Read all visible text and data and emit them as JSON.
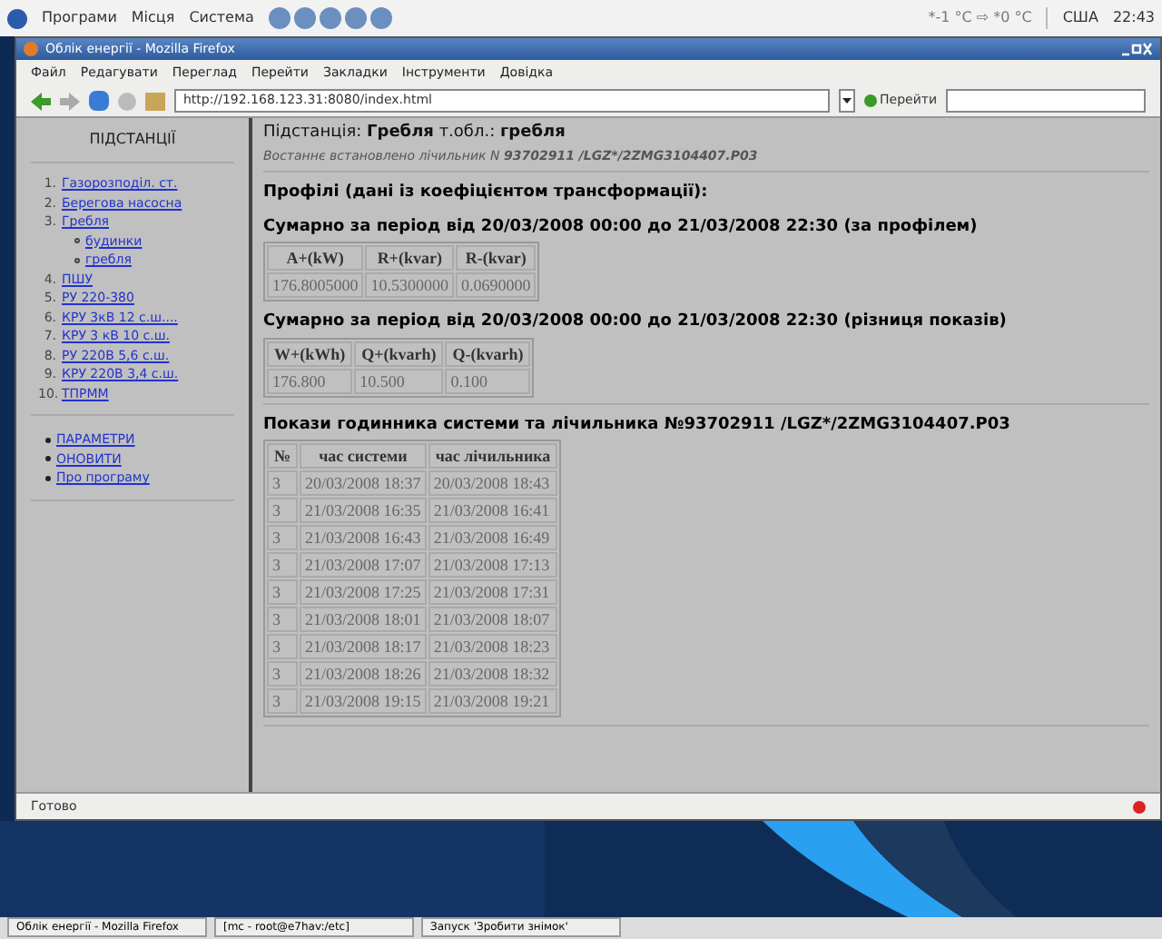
{
  "top_panel": {
    "menus": [
      "Програми",
      "Місця",
      "Система"
    ],
    "weather": "*-1 °C ⇨ *0 °C",
    "keyboard": "США",
    "clock": "22:43"
  },
  "window": {
    "title": "Облік енергії - Mozilla Firefox"
  },
  "menu_bar": [
    "Файл",
    "Редагувати",
    "Переглад",
    "Перейти",
    "Закладки",
    "Інструменти",
    "Довідка"
  ],
  "toolbar": {
    "url": "http://192.168.123.31:8080/index.html",
    "go_button": "Перейти"
  },
  "sidebar": {
    "title": "ПІДСТАНЦІЇ",
    "items": [
      {
        "number": "1.",
        "label": "Газорозподіл. ст."
      },
      {
        "number": "2.",
        "label": "Берегова насосна"
      },
      {
        "number": "3.",
        "label": "Гребля",
        "children": [
          {
            "label": "будинки"
          },
          {
            "label": "гребля"
          }
        ]
      },
      {
        "number": "4.",
        "label": "ПШУ"
      },
      {
        "number": "5.",
        "label": "РУ 220-380"
      },
      {
        "number": "6.",
        "label": "КРУ 3кВ 12 с.ш...."
      },
      {
        "number": "7.",
        "label": "КРУ 3 кВ 10 с.ш."
      },
      {
        "number": "8.",
        "label": "РУ 220В 5,6 с.ш."
      },
      {
        "number": "9.",
        "label": "КРУ 220В 3,4 с.ш."
      },
      {
        "number": "10.",
        "label": "ТПРММ"
      }
    ],
    "links": [
      "ПАРАМЕТРИ",
      "ОНОВИТИ",
      "Про програму"
    ]
  },
  "header": {
    "title": "Підстанція: **Гребля** т.обл.: **гребля**",
    "subtitle": "Востаннє встановлено лічильник N **93702911 /LGZ*/2ZMG3104407.P03**"
  },
  "profiles_heading": "Профілі (дані із коефіцієнтом трансформації):",
  "tables": [
    {
      "caption": "Сумарно за період від 20/03/2008 00:00 до 21/03/2008 22:30 (за профілем)",
      "columns": [
        "A+(kW)",
        "R+(kvar)",
        "R-(kvar)"
      ],
      "rows": [
        [
          "176.8005000",
          "10.5300000",
          "0.0690000"
        ]
      ]
    },
    {
      "caption": "Сумарно за період від 20/03/2008 00:00 до 21/03/2008 22:30 (різниця показів)",
      "columns": [
        "W+(kWh)",
        "Q+(kvarh)",
        "Q-(kvarh)"
      ],
      "rows": [
        [
          "176.800",
          "10.500",
          "0.100"
        ]
      ]
    },
    {
      "caption": "Покази годинника системи та лічильника №93702911 /LGZ*/2ZMG3104407.P03",
      "columns": [
        "№",
        "час системи",
        "час лічильника"
      ],
      "rows": [
        [
          "3",
          "20/03/2008 18:37",
          "20/03/2008 18:43"
        ],
        [
          "3",
          "21/03/2008 16:35",
          "21/03/2008 16:41"
        ],
        [
          "3",
          "21/03/2008 16:43",
          "21/03/2008 16:49"
        ],
        [
          "3",
          "21/03/2008 17:07",
          "21/03/2008 17:13"
        ],
        [
          "3",
          "21/03/2008 17:25",
          "21/03/2008 17:31"
        ],
        [
          "3",
          "21/03/2008 18:01",
          "21/03/2008 18:07"
        ],
        [
          "3",
          "21/03/2008 18:17",
          "21/03/2008 18:23"
        ],
        [
          "3",
          "21/03/2008 18:26",
          "21/03/2008 18:32"
        ],
        [
          "3",
          "21/03/2008 19:15",
          "21/03/2008 19:21"
        ]
      ]
    }
  ],
  "status_bar": "Готово",
  "taskbar": [
    "Облік енергії - Mozilla Firefox",
    "[mc - root@e7hav:/etc]",
    "Запуск 'Зробити знімок'"
  ]
}
